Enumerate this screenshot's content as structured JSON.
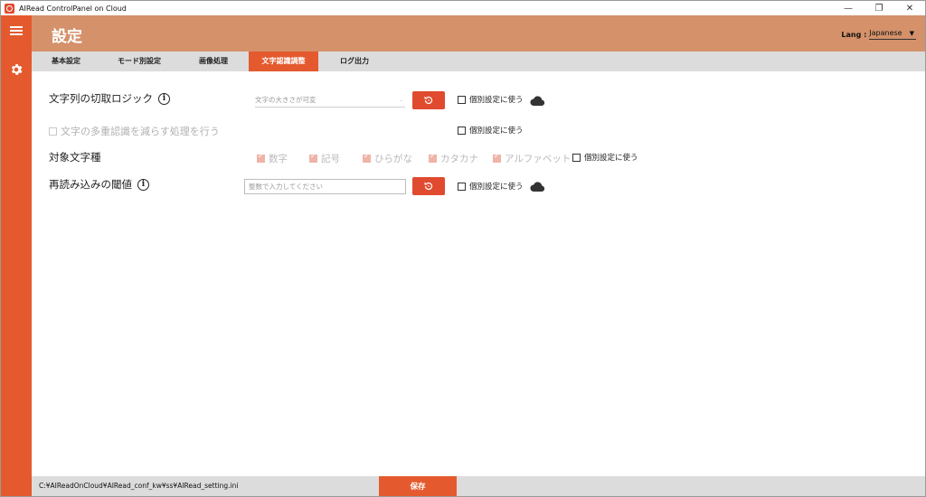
{
  "window": {
    "title": "AIRead ControlPanel on Cloud",
    "controls": {
      "minimize": "—",
      "restore": "❐",
      "close": "✕"
    }
  },
  "header": {
    "title": "設定",
    "lang_label": "Lang :",
    "lang_value": "Japanese"
  },
  "tabs": [
    {
      "label": "基本設定",
      "active": false
    },
    {
      "label": "モード別設定",
      "active": false
    },
    {
      "label": "画像処理",
      "active": false
    },
    {
      "label": "文字認識調整",
      "active": true
    },
    {
      "label": "ログ出力",
      "active": false
    }
  ],
  "settings": {
    "cut_logic": {
      "label": "文字列の切取ロジック",
      "select_value": "文字の大きさが可変",
      "individual": "個別設定に使う"
    },
    "reduce_multi": {
      "label": "文字の多重認識を減らす処理を行う",
      "individual": "個別設定に使う"
    },
    "char_types": {
      "label": "対象文字種",
      "options": [
        "数字",
        "記号",
        "ひらがな",
        "カタカナ",
        "アルファベット"
      ],
      "individual": "個別設定に使う"
    },
    "reread_threshold": {
      "label": "再読み込みの閾値",
      "placeholder": "整数で入力してください",
      "individual": "個別設定に使う"
    }
  },
  "footer": {
    "path": "C:¥AIReadOnCloud¥AIRead_conf_kw¥ss¥AIRead_setting.ini",
    "save_label": "保存"
  },
  "colors": {
    "accent": "#e45a2e",
    "header": "#d4916a",
    "tabbar": "#dcdcdc"
  },
  "icons": [
    "app-logo-icon",
    "hamburger-icon",
    "gear-icon",
    "info-icon",
    "reset-icon",
    "cloud-icon",
    "dropdown-arrow-icon"
  ]
}
